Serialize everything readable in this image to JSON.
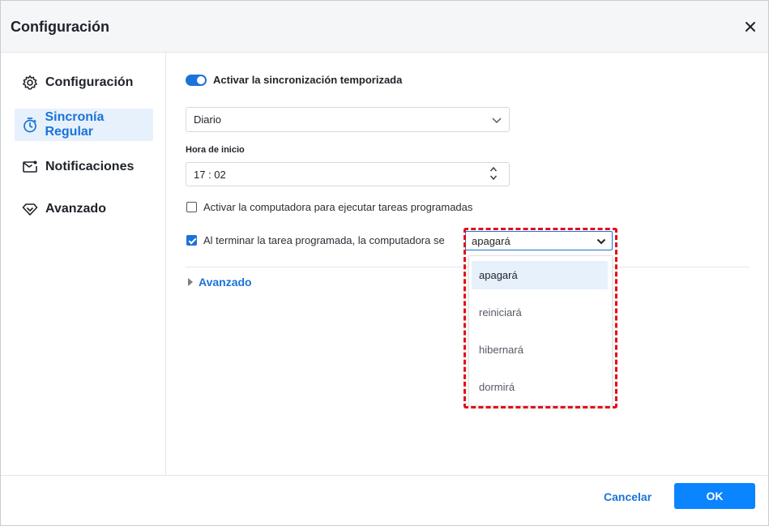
{
  "window": {
    "title": "Configuración"
  },
  "sidebar": {
    "items": [
      {
        "label": "Configuración",
        "icon": "gear-icon",
        "active": false
      },
      {
        "label": "Sincronía Regular",
        "icon": "stopwatch-icon",
        "active": true
      },
      {
        "label": "Notificaciones",
        "icon": "mail-icon",
        "active": false
      },
      {
        "label": "Avanzado",
        "icon": "diamond-icon",
        "active": false
      }
    ]
  },
  "content": {
    "schedule_toggle": {
      "label": "Activar la sincronización temporizada",
      "on": true
    },
    "frequency": {
      "value": "Diario"
    },
    "start_time": {
      "label": "Hora de inicio",
      "value": "17 : 02"
    },
    "wake_option": {
      "label": "Activar la computadora para ejecutar tareas programadas",
      "checked": false
    },
    "after_task_option": {
      "label": "Al terminar la tarea programada, la computadora se",
      "checked": true
    },
    "after_task_select": {
      "value": "apagará",
      "options": [
        "apagará",
        "reiniciará",
        "hibernará",
        "dormirá"
      ]
    },
    "advanced": {
      "label": "Avanzado"
    }
  },
  "footer": {
    "cancel_label": "Cancelar",
    "ok_label": "OK"
  },
  "colors": {
    "accent": "#1a73d9",
    "ok_button": "#0a84ff",
    "highlight_border": "#e0101a"
  }
}
